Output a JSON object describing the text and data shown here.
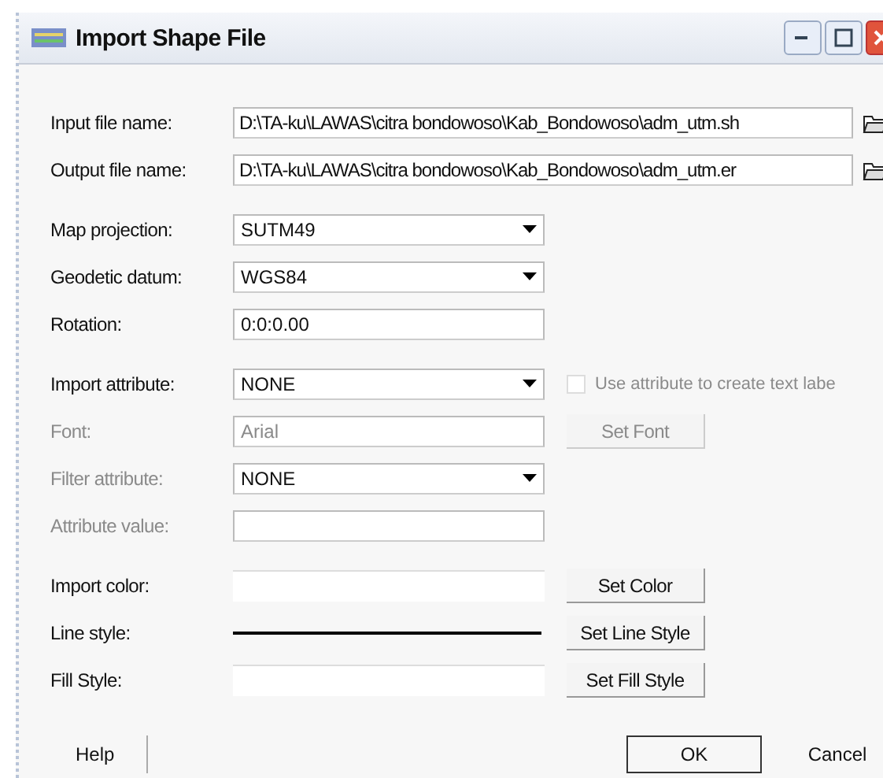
{
  "window": {
    "title": "Import Shape File"
  },
  "groups": [
    [
      {
        "label": "Input file name:",
        "kind": "path",
        "value": "D:\\TA-ku\\LAWAS\\citra bondowoso\\Kab_Bondowoso\\adm_utm.sh",
        "disabled": false,
        "extra": {
          "kind": "browse"
        }
      },
      {
        "label": "Output file name:",
        "kind": "path",
        "value": "D:\\TA-ku\\LAWAS\\citra bondowoso\\Kab_Bondowoso\\adm_utm.er",
        "disabled": false,
        "extra": {
          "kind": "browse"
        }
      }
    ],
    [
      {
        "label": "Map projection:",
        "kind": "combo",
        "value": "SUTM49",
        "disabled": false
      },
      {
        "label": "Geodetic datum:",
        "kind": "combo",
        "value": "WGS84",
        "disabled": false
      },
      {
        "label": "Rotation:",
        "kind": "text",
        "value": "0:0:0.00",
        "disabled": false
      }
    ],
    [
      {
        "label": "Import attribute:",
        "kind": "combo",
        "value": "NONE",
        "disabled": false,
        "extra": {
          "kind": "checkbox",
          "label": "Use attribute to create text labe",
          "checked": false,
          "disabled": true
        }
      },
      {
        "label": "Font:",
        "kind": "text",
        "value": "Arial",
        "disabled": true,
        "extra": {
          "kind": "button",
          "label": "Set Font",
          "disabled": true
        }
      },
      {
        "label": "Filter attribute:",
        "kind": "combo",
        "value": "NONE",
        "disabled": true
      },
      {
        "label": "Attribute value:",
        "kind": "text",
        "disabled": true
      }
    ],
    [
      {
        "label": "Import color:",
        "kind": "swatch",
        "disabled": false,
        "extra": {
          "kind": "button",
          "label": "Set Color",
          "disabled": false
        }
      },
      {
        "label": "Line style:",
        "kind": "line",
        "disabled": false,
        "extra": {
          "kind": "button",
          "label": "Set Line Style",
          "disabled": false
        }
      },
      {
        "label": "Fill Style:",
        "kind": "swatch",
        "disabled": false,
        "extra": {
          "kind": "button",
          "label": "Set Fill Style",
          "disabled": false
        }
      }
    ]
  ],
  "buttons": [
    {
      "label": "Help",
      "kind": "help"
    },
    {
      "label": "OK",
      "kind": "default"
    },
    {
      "label": "Cancel",
      "kind": "normal"
    }
  ]
}
